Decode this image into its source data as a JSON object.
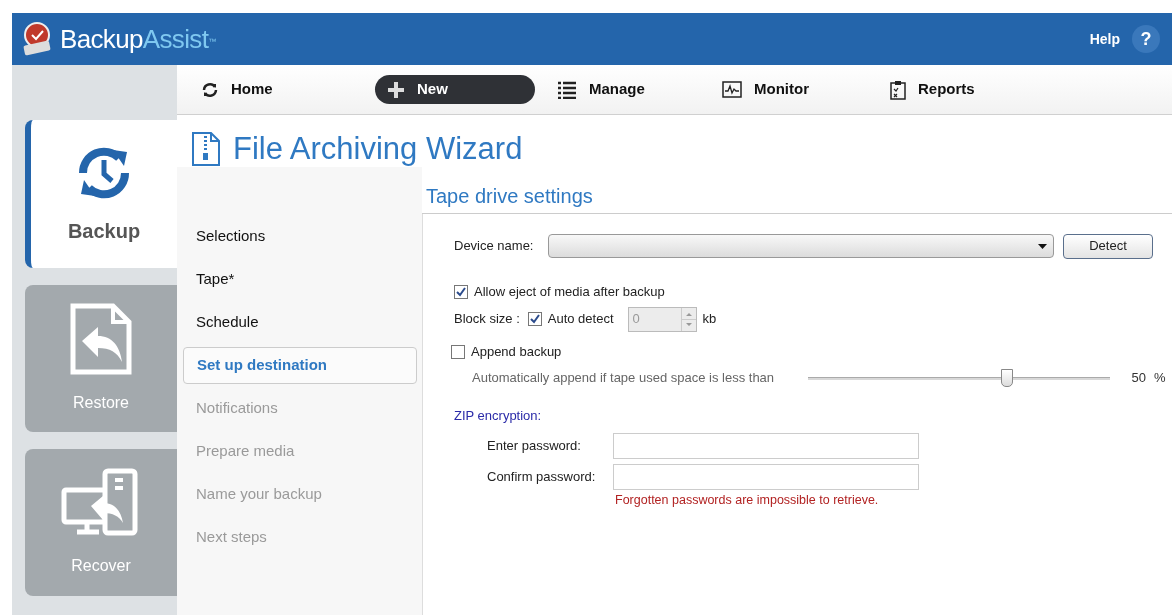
{
  "app": {
    "name_part1": "Backup",
    "name_part2": "Assist",
    "trademark": "™",
    "help": "Help",
    "help_glyph": "?"
  },
  "modes": [
    {
      "label": "Backup",
      "kind": "backup",
      "selected": true
    },
    {
      "label": "Restore",
      "kind": "restore",
      "selected": false
    },
    {
      "label": "Recover",
      "kind": "recover",
      "selected": false
    }
  ],
  "nav": [
    {
      "label": "Home",
      "kind": "home",
      "selected": false
    },
    {
      "label": "New",
      "kind": "new",
      "selected": true
    },
    {
      "label": "Manage",
      "kind": "manage",
      "selected": false
    },
    {
      "label": "Monitor",
      "kind": "monitor",
      "selected": false
    },
    {
      "label": "Reports",
      "kind": "reports",
      "selected": false
    }
  ],
  "wizard_title": "File Archiving Wizard",
  "steps": [
    {
      "label": "Selections",
      "selected": false,
      "disabled": false
    },
    {
      "label": "Tape*",
      "selected": false,
      "disabled": false
    },
    {
      "label": "Schedule",
      "selected": false,
      "disabled": false
    },
    {
      "label": "Set up destination",
      "selected": true,
      "disabled": false
    },
    {
      "label": "Notifications",
      "selected": false,
      "disabled": true
    },
    {
      "label": "Prepare media",
      "selected": false,
      "disabled": true
    },
    {
      "label": "Name your backup",
      "selected": false,
      "disabled": true
    },
    {
      "label": "Next steps",
      "selected": false,
      "disabled": true
    }
  ],
  "section_title": "Tape drive settings",
  "device": {
    "label": "Device name:",
    "button": "Detect"
  },
  "allow_eject": {
    "label": "Allow eject of media after backup",
    "checked": true
  },
  "block_size": {
    "label": "Block size :",
    "auto_label": "Auto detect",
    "auto_checked": true,
    "value": "0",
    "unit": "kb",
    "disabled": true
  },
  "append": {
    "label": "Append backup",
    "checked": false
  },
  "append_threshold": {
    "label": "Automatically append if tape used space is less than",
    "level": 0.66,
    "value": "50",
    "unit": "%"
  },
  "zip": {
    "title": "ZIP encryption:",
    "enter_label": "Enter password:",
    "confirm_label": "Confirm password:",
    "warning": "Forgotten passwords are impossible to retrieve."
  }
}
